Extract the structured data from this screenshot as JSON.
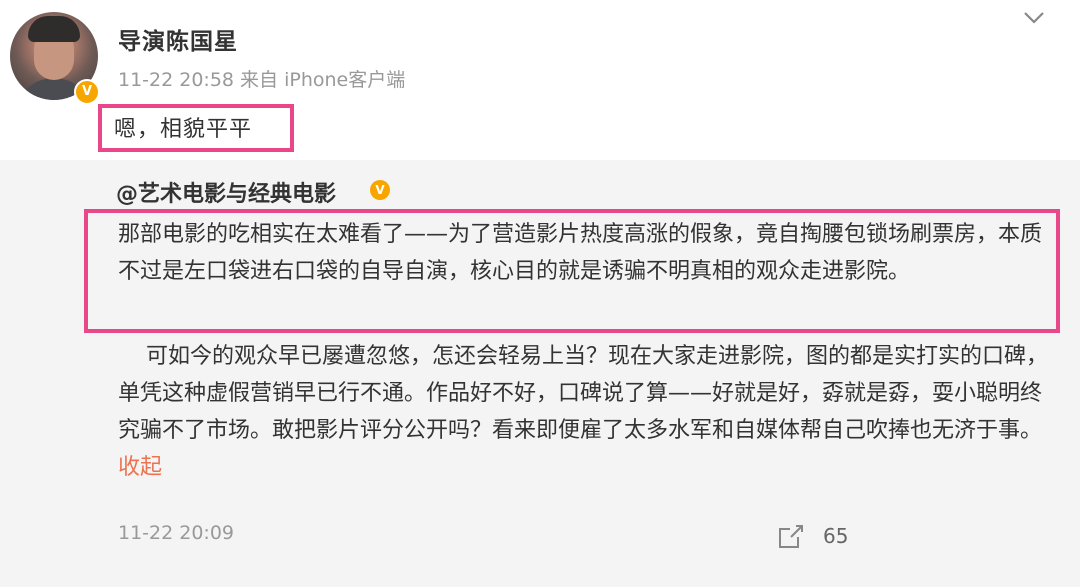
{
  "post": {
    "author": "导演陈国星",
    "meta": "11-22 20:58 来自 iPhone客户端",
    "text": "嗯，相貌平平",
    "verified_badge": "V"
  },
  "repost": {
    "author": "@艺术电影与经典电影",
    "verified_badge": "V",
    "para1": "那部电影的吃相实在太难看了——为了营造影片热度高涨的假象，竟自掏腰包锁场刷票房，本质不过是左口袋进右口袋的自导自演，核心目的就是诱骗不明真相的观众走进影院。",
    "para2": "    可如今的观众早已屡遭忽悠，怎还会轻易上当？现在大家走进影院，图的都是实打实的口碑，单凭这种虚假营销早已行不通。作品好不好，口碑说了算——好就是好，孬就是孬，耍小聪明终究骗不了市场。敢把影片评分公开吗？看来即便雇了太多水军和自媒体帮自己吹捧也无济于事。",
    "collapse_label": "收起",
    "time": "11-22 20:09",
    "share_count": "65"
  },
  "icons": {
    "menu": "chevron-down-icon",
    "share": "share-icon"
  },
  "colors": {
    "highlight_border": "#e8488a",
    "verified_badge": "#f7a600",
    "link": "#eb7350",
    "repost_bg": "#f4f4f4"
  }
}
